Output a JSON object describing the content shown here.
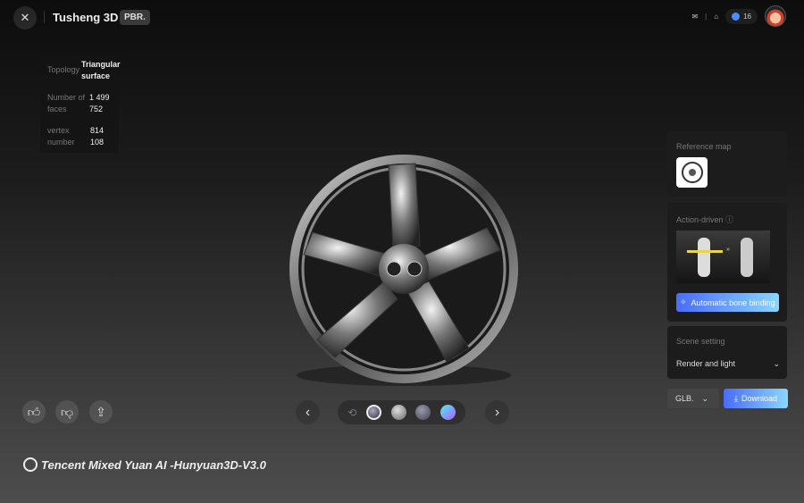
{
  "header": {
    "title": "Tusheng 3D",
    "badge": "PBR.",
    "credits": "16"
  },
  "stats": {
    "topology_label": "Topology",
    "topology_value": "Triangular surface",
    "faces_label": "Number of faces",
    "faces_value_1": "1 499",
    "faces_value_2": "752",
    "vertex_label": "vertex number",
    "vertex_value_1": "814",
    "vertex_value_2": "108"
  },
  "panels": {
    "reference_map": "Reference map",
    "action_driven": "Action-driven",
    "bone_binding": "Automatic bone binding",
    "scene_setting": "Scene setting",
    "render_light": "Render and light"
  },
  "export": {
    "format": "GLB.",
    "download": "Download"
  },
  "brand": "Tencent Mixed Yuan AI -Hunyuan3D-V3.0"
}
